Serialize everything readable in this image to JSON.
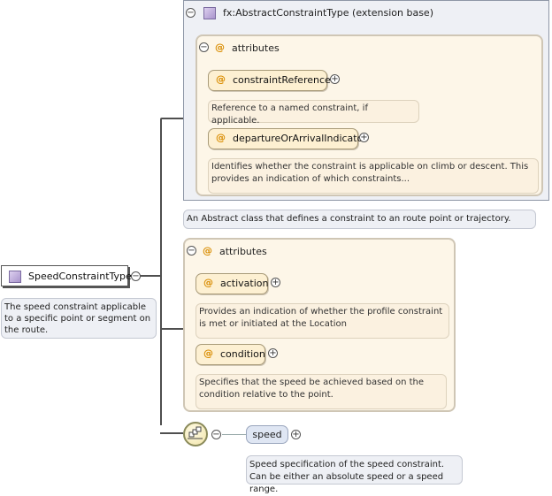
{
  "base_type": {
    "title": "fx:AbstractConstraintType (extension base)",
    "description": "An Abstract class that defines a constraint to an route point or trajectory.",
    "attributes_group": {
      "title": "attributes",
      "items": [
        {
          "name": "constraintReference",
          "doc": "Reference to a named constraint, if applicable."
        },
        {
          "name": "departureOrArrivalIndicator",
          "doc": "Identifies whether the constraint is applicable on climb or descent. This provides an indication of which constraints..."
        }
      ]
    }
  },
  "main_element": {
    "name": "SpeedConstraintType",
    "doc": "The speed constraint applicable to a specific point or segment on the route."
  },
  "own_attributes": {
    "title": "attributes",
    "items": [
      {
        "name": "activation",
        "doc": "Provides an indication of whether the profile constraint is met or initiated at the Location"
      },
      {
        "name": "condition",
        "doc": "Specifies that the speed be achieved based on the condition relative to the point."
      }
    ]
  },
  "sequence": {
    "child": {
      "name": "speed",
      "doc": "Speed specification of the speed constraint. Can be either an absolute speed or a speed range."
    }
  },
  "symbols": {
    "collapse": "−",
    "expand": "+",
    "attribute": "@"
  },
  "colors": {
    "attribute_marker": "#d98c00",
    "attribute_fill": "#fdf0d2",
    "group_fill": "#fdf6e8",
    "base_fill": "#eef0f5",
    "element_fill": "#dfe6f3"
  }
}
